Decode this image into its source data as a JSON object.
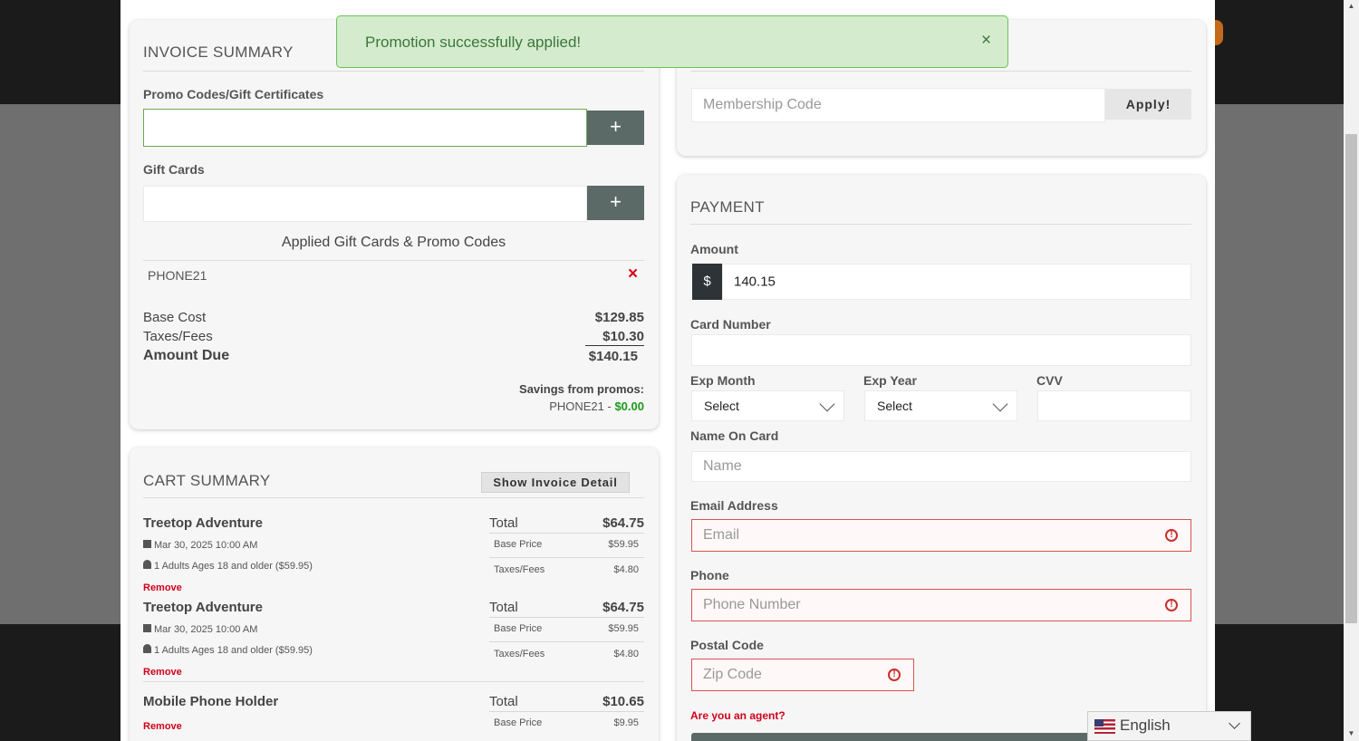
{
  "toast": {
    "message": "Promotion successfully applied!",
    "close": "×"
  },
  "invoice": {
    "title": "INVOICE SUMMARY",
    "promo_label": "Promo Codes/Gift Certificates",
    "promo_value": "",
    "gift_label": "Gift Cards",
    "add_icon": "+",
    "applied_title": "Applied Gift Cards & Promo Codes",
    "applied_code": "PHONE21",
    "remove_icon": "×",
    "base_cost_label": "Base Cost",
    "base_cost": "$129.85",
    "taxes_label": "Taxes/Fees",
    "taxes": "$10.30",
    "amount_due_label": "Amount Due",
    "amount_due": "$140.15",
    "savings_label": "Savings from promos:",
    "savings_code": "PHONE21 - ",
    "savings_amount": "$0.00"
  },
  "membership": {
    "placeholder": "Membership Code",
    "apply": "Apply!"
  },
  "cart": {
    "title": "CART SUMMARY",
    "show_detail": "Show Invoice Detail",
    "total_label": "Total",
    "base_price_label": "Base Price",
    "taxes_label": "Taxes/Fees",
    "remove_label": "Remove",
    "items": [
      {
        "name": "Treetop Adventure",
        "date": "Mar 30, 2025 10:00 AM",
        "guests": "1 Adults Ages 18 and older ($59.95)",
        "total": "$64.75",
        "base": "$59.95",
        "taxes": "$4.80"
      },
      {
        "name": "Treetop Adventure",
        "date": "Mar 30, 2025 10:00 AM",
        "guests": "1 Adults Ages 18 and older ($59.95)",
        "total": "$64.75",
        "base": "$59.95",
        "taxes": "$4.80"
      },
      {
        "name": "Mobile Phone Holder",
        "total": "$10.65",
        "base": "$9.95"
      }
    ]
  },
  "payment": {
    "title": "PAYMENT",
    "amount_label": "Amount",
    "currency": "$",
    "amount_value": "140.15",
    "card_number_label": "Card Number",
    "exp_month_label": "Exp Month",
    "exp_year_label": "Exp Year",
    "cvv_label": "CVV",
    "select": "Select",
    "name_label": "Name On Card",
    "name_placeholder": "Name",
    "email_label": "Email Address",
    "email_placeholder": "Email",
    "phone_label": "Phone",
    "phone_placeholder": "Phone Number",
    "postal_label": "Postal Code",
    "postal_placeholder": "Zip Code",
    "agent_link": "Are you an agent?"
  },
  "language": {
    "label": "English"
  },
  "colors": {
    "toast_bg": "#d4eccd",
    "button_dark": "#5b6a66",
    "error_red": "#d0021b",
    "savings_green": "#1a9a1a"
  }
}
